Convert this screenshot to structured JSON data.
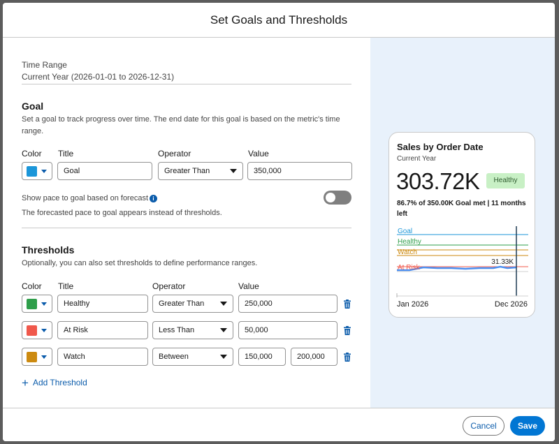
{
  "dialog": {
    "title": "Set Goals and Thresholds"
  },
  "time_range": {
    "label": "Time Range",
    "value": "Current Year (2026-01-01 to 2026-12-31)"
  },
  "goal": {
    "heading": "Goal",
    "description_line1": "Set a goal to track progress over time. The end date for this goal is based on the metric's time",
    "description_line2": "range.",
    "col_color": "Color",
    "col_title": "Title",
    "col_operator": "Operator",
    "col_value": "Value",
    "color": "#1b96d9",
    "title": "Goal",
    "operator": "Greater Than",
    "value": "350,000",
    "pace_label": "Show pace to goal based on forecast",
    "pace_enabled": false,
    "pace_note": "The forecasted pace to goal appears instead of thresholds."
  },
  "thresholds": {
    "heading": "Thresholds",
    "description": "Optionally, you can also set thresholds to define performance ranges.",
    "col_color": "Color",
    "col_title": "Title",
    "col_operator": "Operator",
    "col_value": "Value",
    "rows": [
      {
        "color": "#2e9e4a",
        "title": "Healthy",
        "operator": "Greater Than",
        "value": "250,000"
      },
      {
        "color": "#f0584b",
        "title": "At Risk",
        "operator": "Less Than",
        "value": "50,000"
      },
      {
        "color": "#cc8a10",
        "title": "Watch",
        "operator": "Between",
        "value": "150,000",
        "value2": "200,000"
      }
    ],
    "add_label": "Add Threshold",
    "add_symbol": "+"
  },
  "preview": {
    "title": "Sales by Order Date",
    "subtitle": "Current Year",
    "value": "303.72K",
    "badge": "Healthy",
    "summary_line1": "86.7% of 350.00K Goal met | 11 months",
    "summary_line2": "left",
    "lines": {
      "goal": "Goal",
      "healthy": "Healthy",
      "watch": "Watch",
      "at_risk": "At Risk"
    },
    "current_label": "31.33K",
    "x_start": "Jan 2026",
    "x_end": "Dec 2026"
  },
  "footer": {
    "cancel": "Cancel",
    "save": "Save"
  },
  "colors": {
    "brand": "#0b5cab",
    "save_bg": "#0176d3",
    "panel_bg": "#e8f1fb",
    "badge_bg": "#c8f0c5"
  }
}
